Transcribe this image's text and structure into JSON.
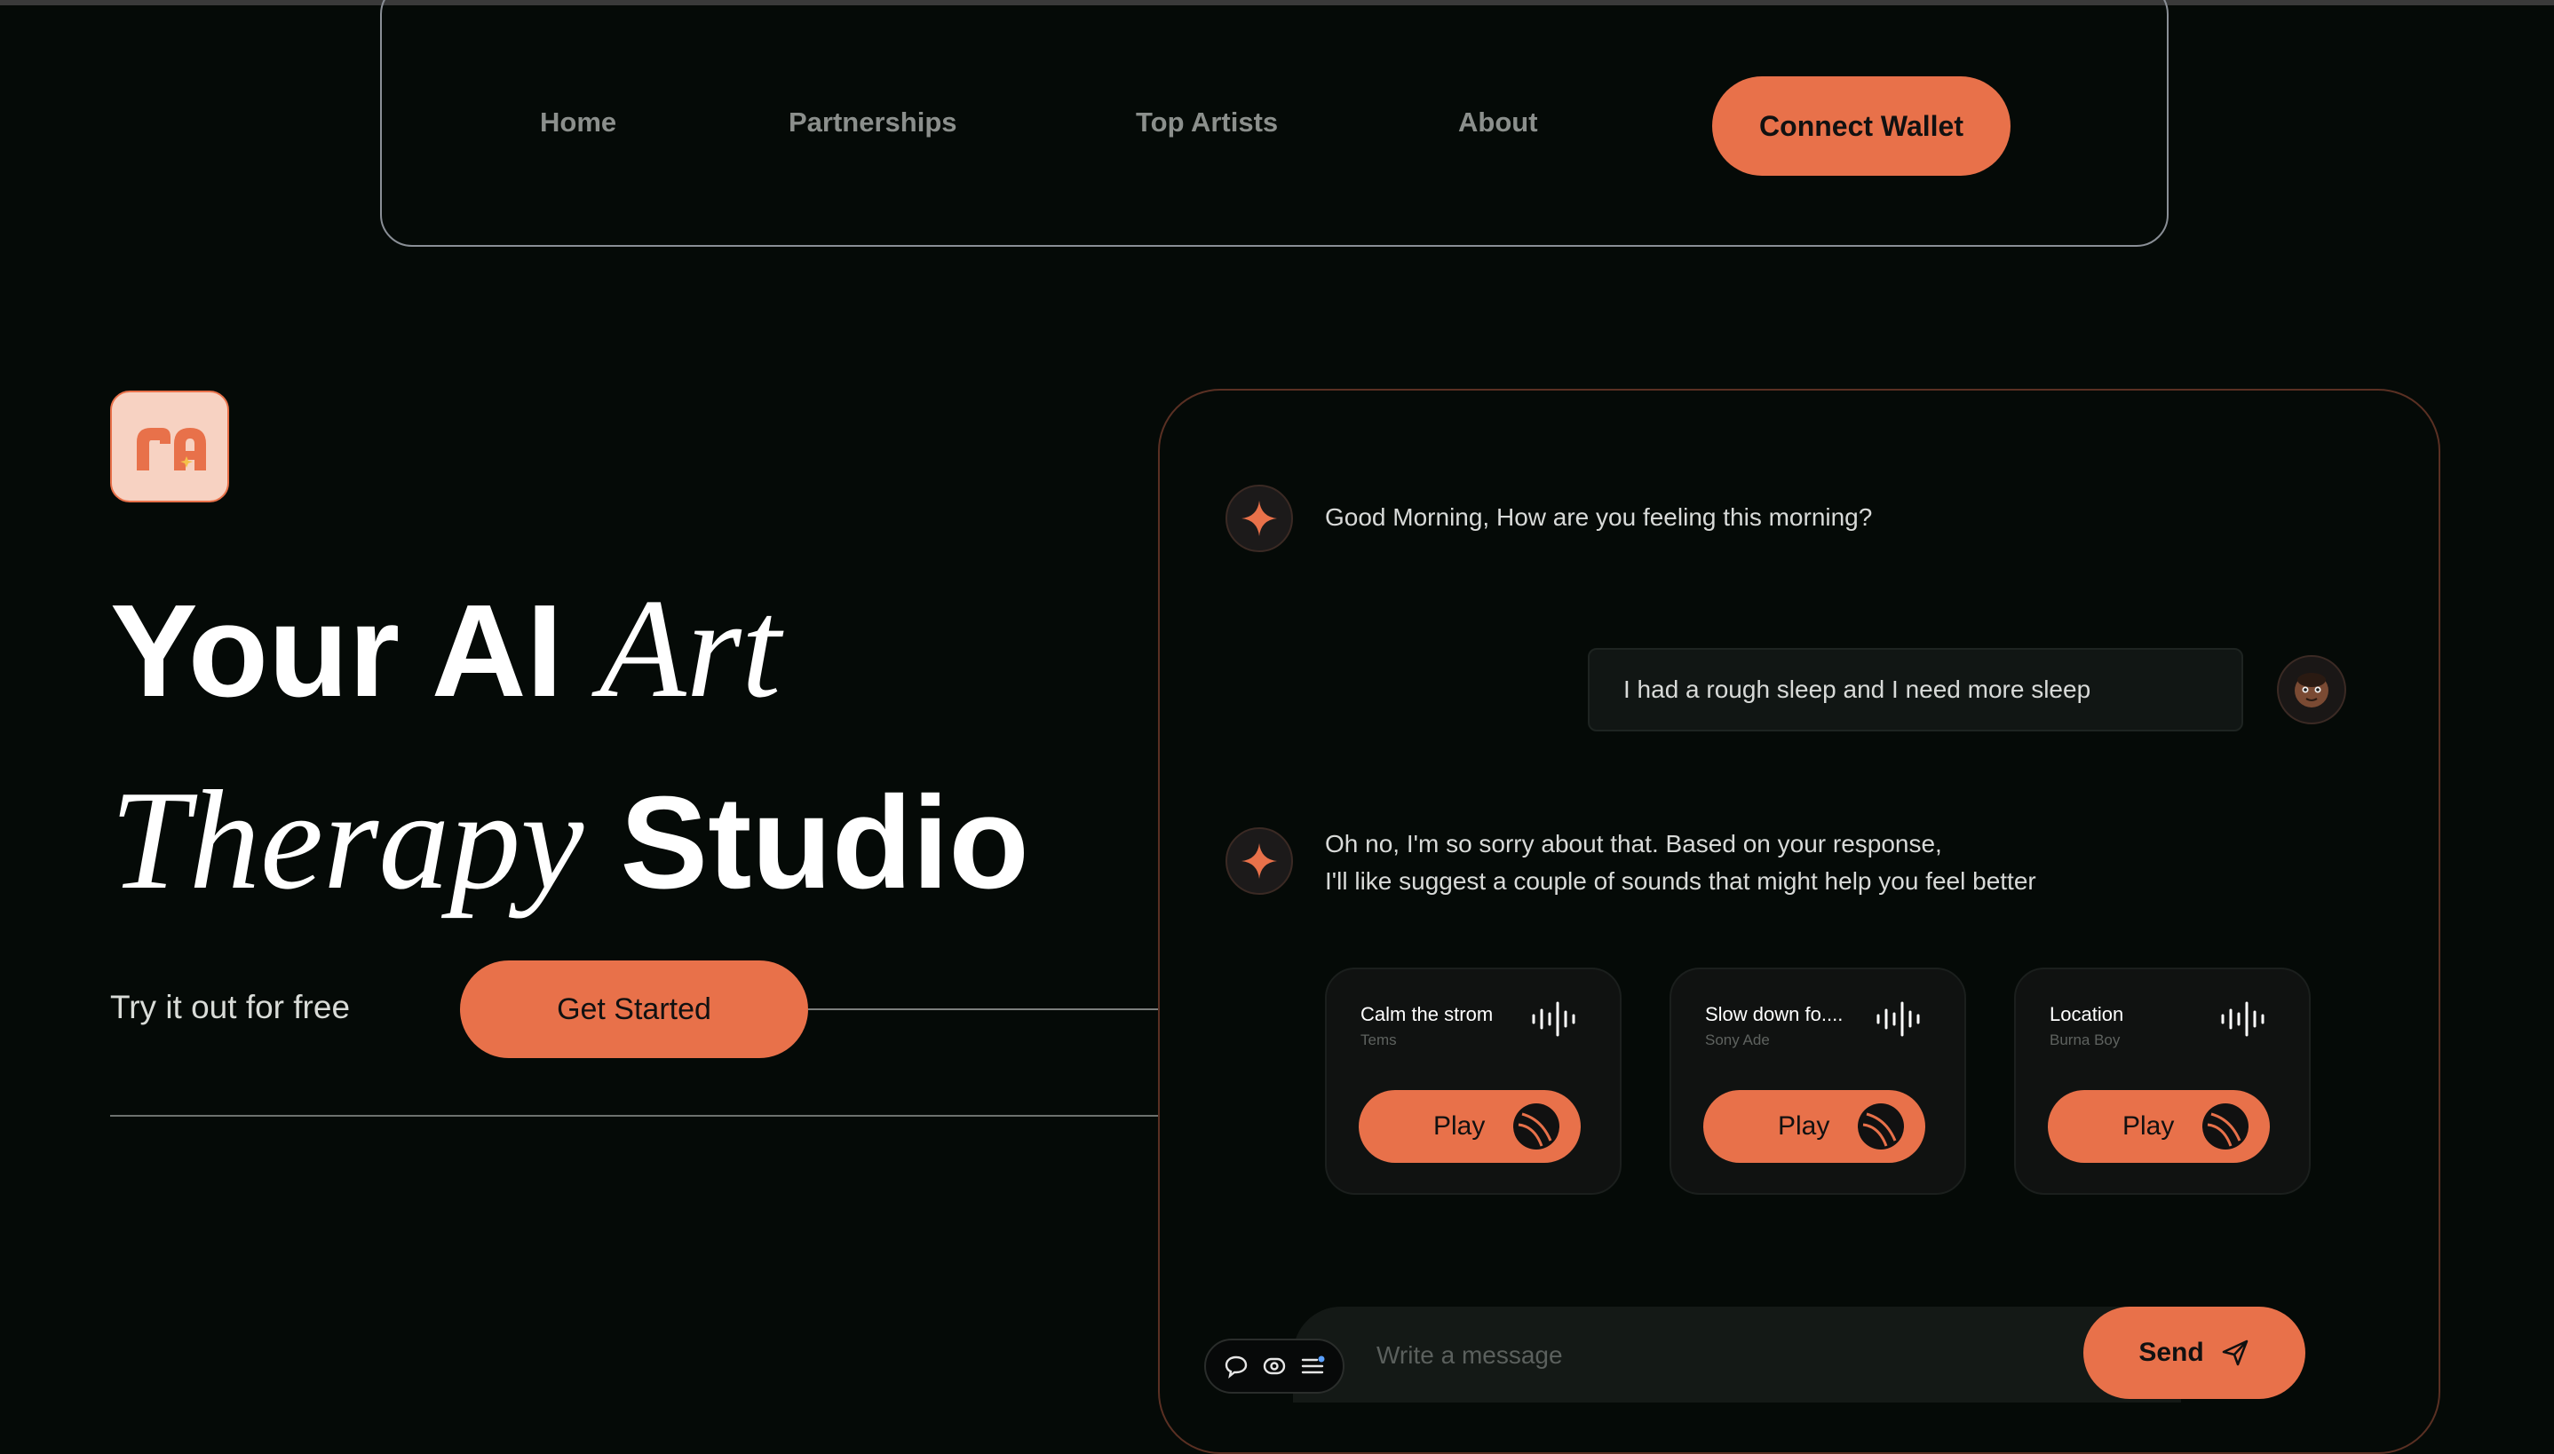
{
  "colors": {
    "background": "#050a07",
    "accent": "#e8714a",
    "nav_text": "#8b8f8c",
    "logo_bg": "#f7d2c2"
  },
  "nav": {
    "items": [
      {
        "label": "Home"
      },
      {
        "label": "Partnerships"
      },
      {
        "label": "Top Artists"
      },
      {
        "label": "About"
      }
    ],
    "connect_label": "Connect Wallet"
  },
  "logo": {
    "icon": "ra-logo-icon"
  },
  "hero": {
    "line1_bold": "Your AI",
    "line1_italic": "Art",
    "line2_italic": "Therapy",
    "line2_bold": "Studio",
    "try_text": "Try it out for free",
    "cta_label": "Get Started"
  },
  "chat": {
    "bot_message_1": "Good Morning, How are you feeling this morning?",
    "user_message": "I had a rough sleep and I need more sleep",
    "bot_message_2_line1": "Oh no, I'm so sorry about that. Based on your response,",
    "bot_message_2_line2": "I'll like suggest a couple of sounds that might help you feel better",
    "tracks": [
      {
        "title": "Calm the strom",
        "artist": "Tems",
        "play_label": "Play"
      },
      {
        "title": "Slow down fo....",
        "artist": "Sony Ade",
        "play_label": "Play"
      },
      {
        "title": "Location",
        "artist": "Burna Boy",
        "play_label": "Play"
      }
    ],
    "input_placeholder": "Write a message",
    "send_label": "Send"
  },
  "toolbar": {
    "icons": [
      "comment-icon",
      "eye-icon",
      "menu-icon"
    ]
  }
}
